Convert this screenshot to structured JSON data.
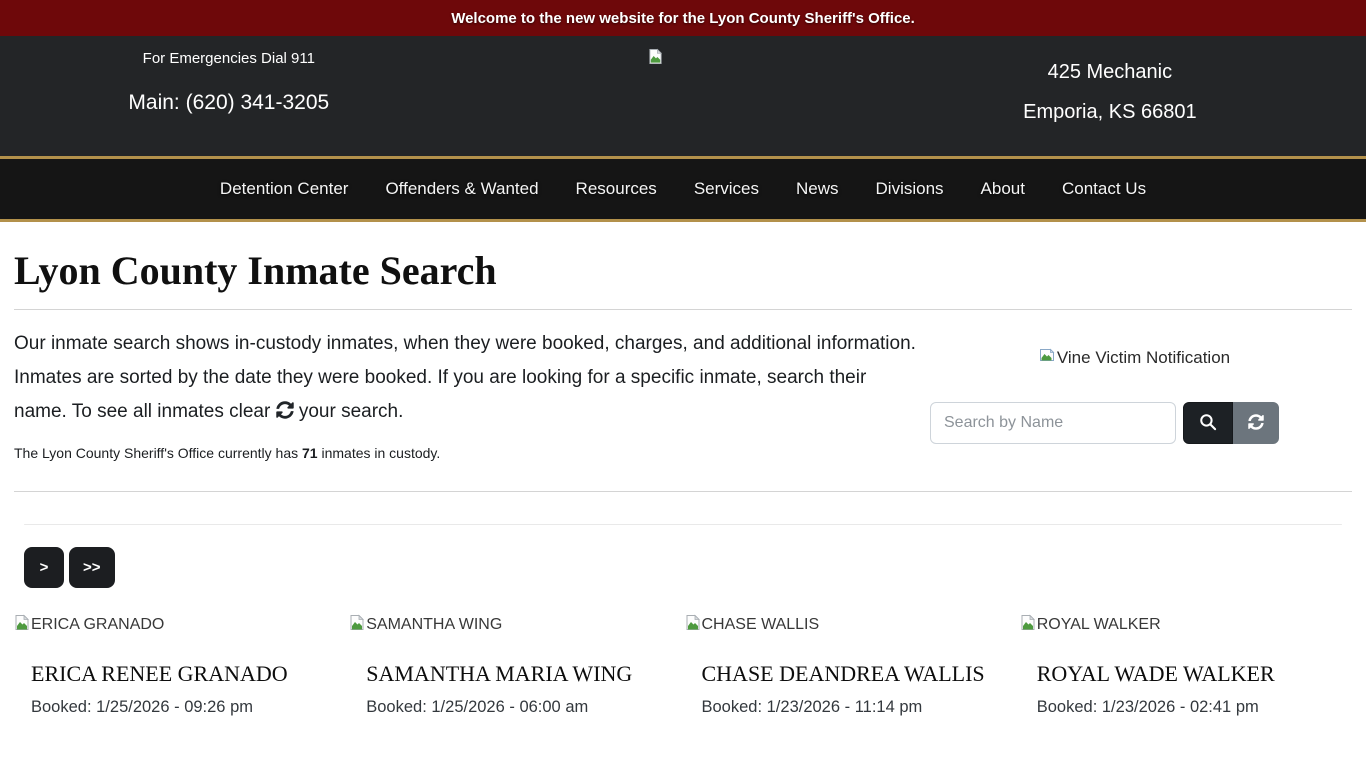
{
  "banner": {
    "text": "Welcome to the new website for the Lyon County Sheriff's Office."
  },
  "header": {
    "emergency_text": "For Emergencies Dial 911",
    "phone_text": "Main: (620) 341-3205",
    "address_line1": "425 Mechanic",
    "address_line2": "Emporia, KS 66801"
  },
  "nav": {
    "items": [
      {
        "label": "Detention Center"
      },
      {
        "label": "Offenders & Wanted"
      },
      {
        "label": "Resources"
      },
      {
        "label": "Services"
      },
      {
        "label": "News"
      },
      {
        "label": "Divisions"
      },
      {
        "label": "About"
      },
      {
        "label": "Contact Us"
      }
    ]
  },
  "main": {
    "title": "Lyon County Inmate Search",
    "intro_before_icon": "Our inmate search shows in-custody inmates, when they were booked, charges, and additional information. Inmates are sorted by the date they were booked. If you are looking for a specific inmate, search their name. To see all inmates clear ",
    "intro_after_icon": " your search.",
    "custody_before": "The Lyon County Sheriff's Office currently has ",
    "custody_count": "71",
    "custody_after": " inmates in custody.",
    "vine_label": "Vine Victim Notification",
    "search": {
      "placeholder": "Search by Name"
    }
  },
  "pagination": {
    "next_label": ">",
    "last_label": ">>"
  },
  "inmates": [
    {
      "alt": "ERICA GRANADO",
      "name": "ERICA RENEE GRANADO",
      "booked": "Booked: 1/25/2026 - 09:26 pm"
    },
    {
      "alt": "SAMANTHA WING",
      "name": "SAMANTHA MARIA WING",
      "booked": "Booked: 1/25/2026 - 06:00 am"
    },
    {
      "alt": "CHASE WALLIS",
      "name": "CHASE DEANDREA WALLIS",
      "booked": "Booked: 1/23/2026 - 11:14 pm"
    },
    {
      "alt": "ROYAL WALKER",
      "name": "ROYAL WADE WALKER",
      "booked": "Booked: 1/23/2026 - 02:41 pm"
    }
  ],
  "icons": {
    "search": "magnifying-glass",
    "refresh": "circular-sync-arrows",
    "broken_image": "broken-image-placeholder"
  },
  "colors": {
    "banner_red": "#6e080a",
    "header_bg": "#232527",
    "nav_bg": "#151515",
    "gold_accent": "#b3914b",
    "button_dark": "#1d2125",
    "button_gray": "#6c757d"
  }
}
